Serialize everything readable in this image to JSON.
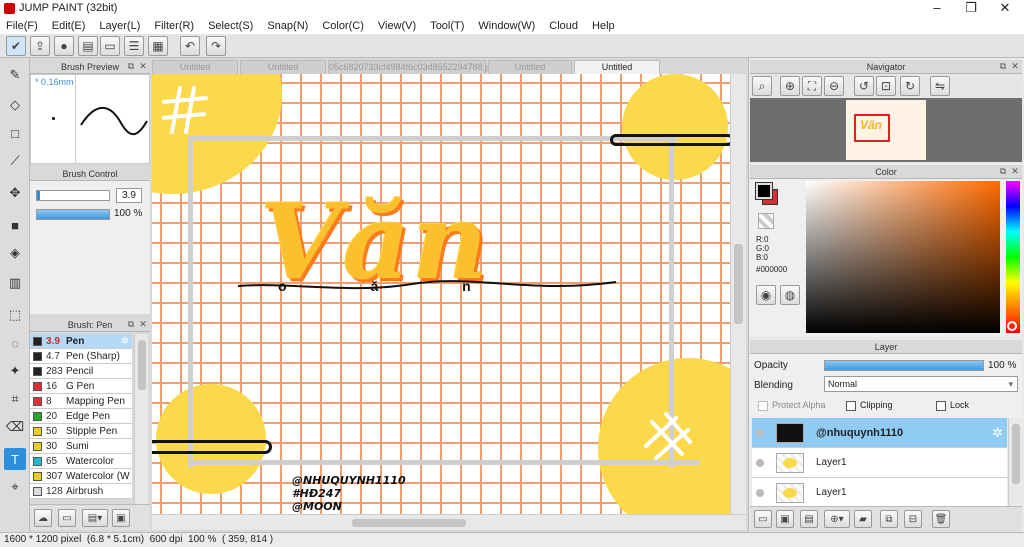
{
  "window": {
    "title": "JUMP PAINT (32bit)",
    "minimize": "–",
    "maximize": "❐",
    "close": "✕"
  },
  "menu": [
    "File(F)",
    "Edit(E)",
    "Layer(L)",
    "Filter(R)",
    "Select(S)",
    "Snap(N)",
    "Color(C)",
    "View(V)",
    "Tool(T)",
    "Window(W)",
    "Cloud",
    "Help"
  ],
  "brush_preview": {
    "title": "Brush Preview",
    "size_label": "* 0.16mm"
  },
  "brush_control": {
    "title": "Brush Control",
    "size_value": "3.9",
    "opacity_value": "100 %",
    "opacity_fraction": 1.0
  },
  "brush_list": {
    "title": "Brush: Pen",
    "items": [
      {
        "size": "3.9",
        "name": "Pen",
        "color": "#222222",
        "selected": true
      },
      {
        "size": "4.7",
        "name": "Pen (Sharp)",
        "color": "#222222"
      },
      {
        "size": "283",
        "name": "Pencil",
        "color": "#222222"
      },
      {
        "size": "16",
        "name": "G Pen",
        "color": "#e03030"
      },
      {
        "size": "8",
        "name": "Mapping Pen",
        "color": "#e03030"
      },
      {
        "size": "20",
        "name": "Edge Pen",
        "color": "#22aa22"
      },
      {
        "size": "50",
        "name": "Stipple Pen",
        "color": "#e8d020"
      },
      {
        "size": "30",
        "name": "Sumi",
        "color": "#e8d020"
      },
      {
        "size": "65",
        "name": "Watercolor",
        "color": "#22bbcc"
      },
      {
        "size": "307",
        "name": "Watercolor (W",
        "color": "#e8d020"
      },
      {
        "size": "128",
        "name": "Airbrush",
        "color": "#dddddd"
      }
    ]
  },
  "tabs": [
    {
      "label": "Untitled",
      "active": false
    },
    {
      "label": "Untitled",
      "active": false
    },
    {
      "label": "05c6820733cf4984f6c03d8552294788.jpg",
      "active": false
    },
    {
      "label": "Untitled",
      "active": false
    },
    {
      "label": "Untitled",
      "active": true
    }
  ],
  "artwork": {
    "title_text": "Văn",
    "subtitle_text": "o ă n",
    "credit_lines": [
      "@NHUQUYNH1110",
      "#HĐ247",
      "@MOON"
    ]
  },
  "navigator": {
    "title": "Navigator",
    "thumb_text": "Văn"
  },
  "color": {
    "title": "Color",
    "r": "R:0",
    "g": "G:0",
    "b": "B:0",
    "hex": "#000000",
    "fg": "#000000",
    "bg": "#cc3333"
  },
  "layer": {
    "title": "Layer",
    "opacity_label": "Opacity",
    "opacity_value": "100 %",
    "opacity_fraction": 1.0,
    "blending_label": "Blending",
    "blending_value": "Normal",
    "protect_alpha": "Protect Alpha",
    "clipping": "Clipping",
    "lock": "Lock",
    "layers": [
      {
        "name": "@nhuquynh1110",
        "selected": true
      },
      {
        "name": "Layer1",
        "selected": false
      },
      {
        "name": "Layer1",
        "selected": false
      }
    ]
  },
  "status": {
    "dimensions": "1600 * 1200 pixel",
    "physical": "(6.8 * 5.1cm)",
    "dpi": "600 dpi",
    "zoom": "100 %",
    "coords": "( 359, 814 )"
  },
  "accent": "#2d8fdc"
}
